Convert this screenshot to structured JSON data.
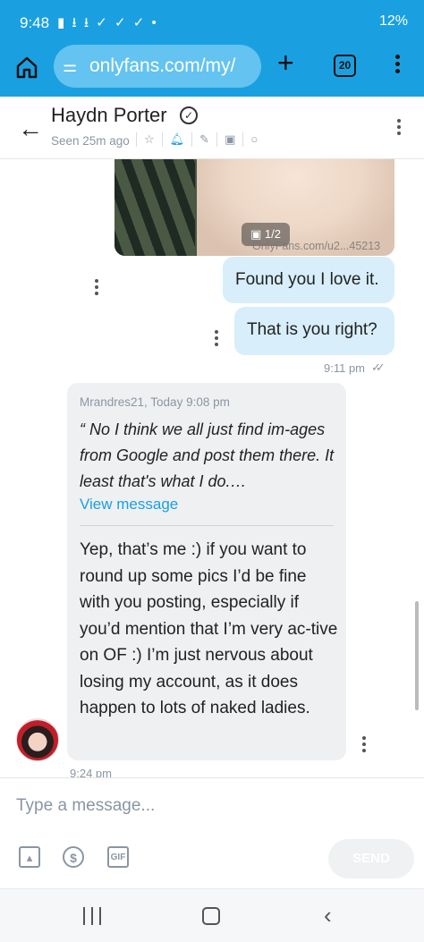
{
  "status_bar": {
    "time": "9:48",
    "icons": "▮ ⭳ ⭳ ✓ ✓ ✓ •",
    "wifi_signal": "⌔ .ıl",
    "battery": "12%"
  },
  "browser": {
    "url": "onlyfans.com/my/",
    "tab_count": "20",
    "home_icon": "home-icon",
    "add_icon": "plus-icon",
    "menu_icon": "more-vertical-icon"
  },
  "chat_header": {
    "name": "Haydn Porter",
    "verified_icon": "verified-badge-icon",
    "seen": "Seen 25m ago",
    "icons": [
      "star-icon",
      "bell-icon",
      "pin-icon",
      "image-icon",
      "search-icon"
    ],
    "icon_glyphs": [
      "☆",
      "♫",
      "✎",
      "▣",
      "○"
    ]
  },
  "messages": {
    "photo": {
      "counter": "1/2",
      "watermark": "OnlyFans.com/u2...45213"
    },
    "out_1": "Found you I love it.",
    "out_2": "That is you right?",
    "out_time": "9:11 pm",
    "in_1": {
      "reply_meta": "Mrandres21, Today 9:08 pm",
      "reply_quote": "“ No I think we all just find im-ages from Google and post them there. It least that's what I do.…",
      "view_message": "View message",
      "text": "Yep, that’s me :) if you want to round up some pics I’d be fine with you posting, especially if you’d mention that I’m very ac-tive on OF :) I’m just nervous about losing my account, as it does happen to lots of naked ladies.",
      "time": "9:24 pm"
    }
  },
  "composer": {
    "placeholder": "Type a message...",
    "send_label": "SEND",
    "icons": [
      "image-icon",
      "dollar-icon",
      "gif-icon"
    ]
  },
  "nav": {
    "icons": [
      "recents-icon",
      "home-icon",
      "back-icon"
    ]
  }
}
